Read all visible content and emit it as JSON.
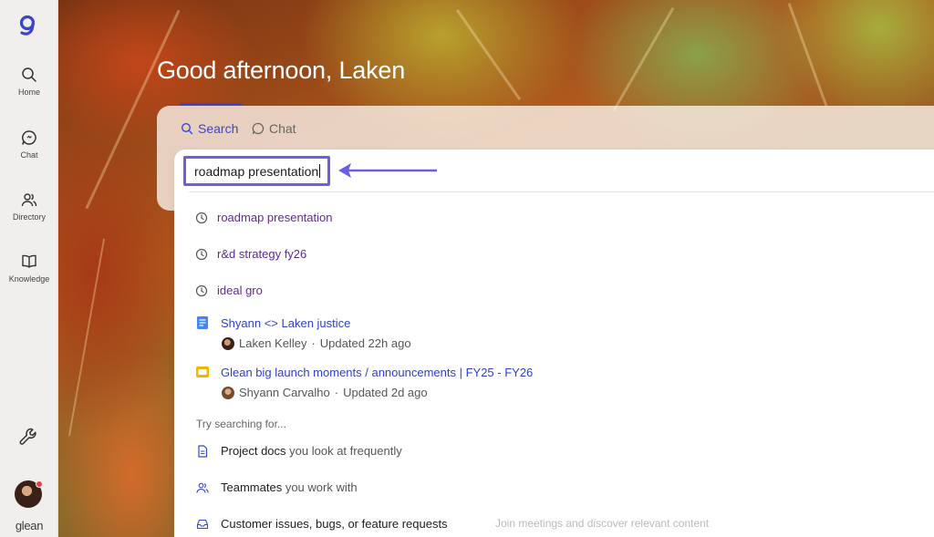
{
  "sidebar": {
    "items": [
      {
        "label": "Home",
        "icon": "search-icon"
      },
      {
        "label": "Chat",
        "icon": "chat-icon"
      },
      {
        "label": "Directory",
        "icon": "people-icon"
      },
      {
        "label": "Knowledge",
        "icon": "book-icon"
      }
    ],
    "tools_icon": "wrench-icon",
    "brand": "glean"
  },
  "greeting": "Good afternoon, Laken",
  "tabs": {
    "search": "Search",
    "chat": "Chat"
  },
  "search": {
    "query": "roadmap presentation"
  },
  "recent": [
    "roadmap presentation",
    "r&d strategy fy26",
    "ideal gro"
  ],
  "documents": [
    {
      "title": "Shyann <> Laken justice",
      "author": "Laken Kelley",
      "updated": "Updated 22h ago",
      "type": "doc",
      "color": "#4285f4"
    },
    {
      "title": "Glean big launch moments / announcements | FY25 - FY26",
      "author": "Shyann Carvalho",
      "updated": "Updated 2d ago",
      "type": "slides",
      "color": "#f4b400"
    }
  ],
  "separator": " · ",
  "try_heading": "Try searching for...",
  "suggestions": [
    {
      "strong": "Project docs",
      "rest": " you look at frequently",
      "icon": "document-icon"
    },
    {
      "strong": "Teammates",
      "rest": " you work with",
      "icon": "people-icon"
    },
    {
      "strong": "Customer issues, bugs, or feature requests",
      "rest": "",
      "icon": "inbox-icon"
    }
  ],
  "caption": "Join meetings and discover relevant content",
  "colors": {
    "accent": "#3b45c8",
    "highlight_box": "#6b5ee3",
    "recent_text": "#5a2d91"
  }
}
